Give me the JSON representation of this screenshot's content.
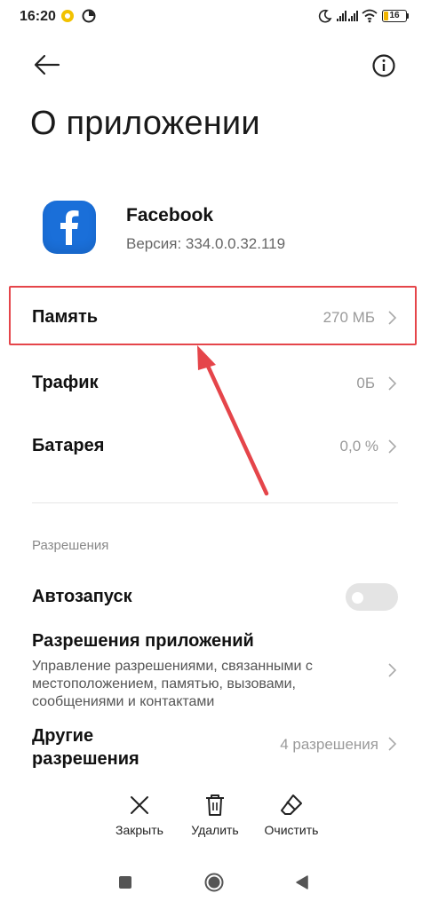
{
  "status_bar": {
    "time": "16:20",
    "battery_level": "16",
    "icons": [
      "notification-badge-icon",
      "timer-icon",
      "moon-icon",
      "signal-icon",
      "signal-icon",
      "wifi-icon",
      "battery-icon"
    ]
  },
  "header": {
    "back_icon": "arrow-left-icon",
    "info_icon": "info-icon",
    "title": "О приложении"
  },
  "app": {
    "icon": "facebook-icon",
    "name": "Facebook",
    "version": "Версия: 334.0.0.32.119",
    "brand_color": "#1a6fd9"
  },
  "usage": [
    {
      "label": "Память",
      "value": "270 МБ"
    },
    {
      "label": "Трафик",
      "value": "0Б"
    },
    {
      "label": "Батарея",
      "value": "0,0 %"
    }
  ],
  "permissions": {
    "header": "Разрешения",
    "autostart_label": "Автозапуск",
    "autostart_enabled": false,
    "app_permissions_title": "Разрешения приложений",
    "app_permissions_desc": "Управление разрешениями, связанными с местоположением, памятью, вызовами, сообщениями и контактами",
    "other_title": "Другие разрешения",
    "other_value": "4 разрешения"
  },
  "actions": [
    {
      "label": "Закрыть",
      "icon": "close-icon"
    },
    {
      "label": "Удалить",
      "icon": "trash-icon"
    },
    {
      "label": "Очистить",
      "icon": "eraser-icon"
    }
  ],
  "nav_bar": {
    "icons": [
      "square-icon",
      "circle-icon",
      "triangle-back-icon"
    ]
  },
  "annotation_color": "#e5454a"
}
